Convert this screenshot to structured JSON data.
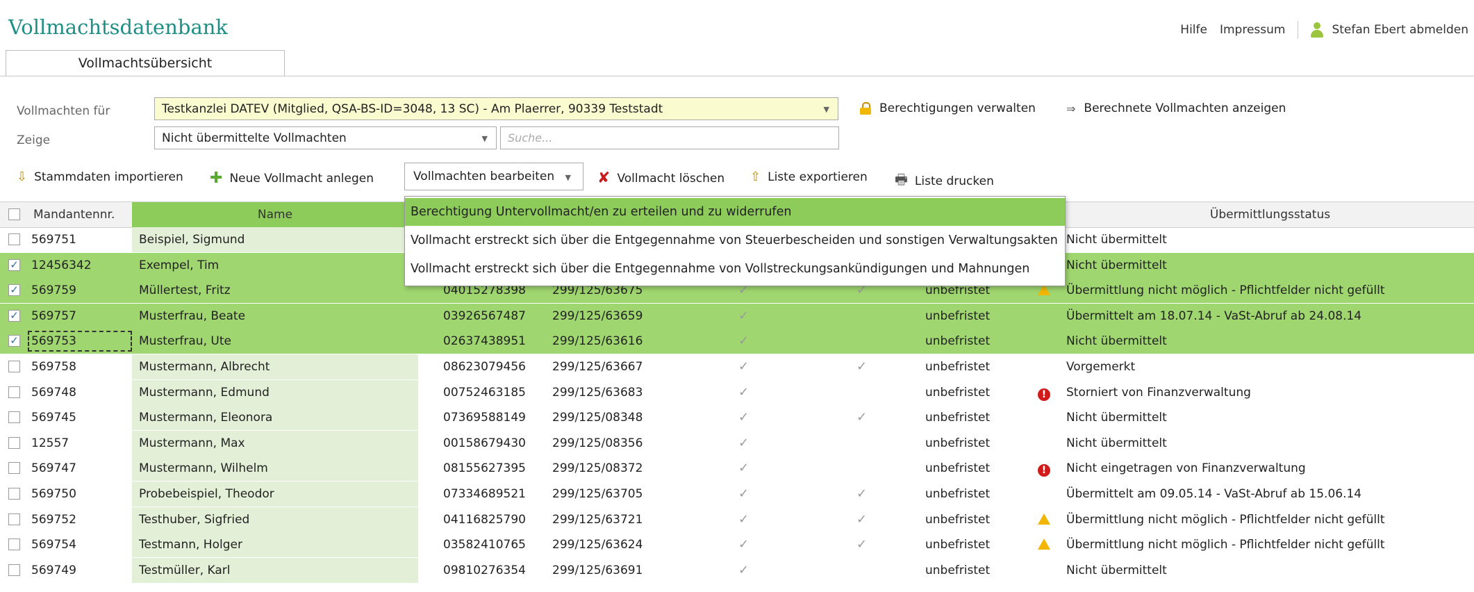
{
  "header": {
    "app_title": "Vollmachtsdatenbank",
    "help": "Hilfe",
    "imprint": "Impressum",
    "user_logout": "Stefan Ebert abmelden"
  },
  "tabs": [
    {
      "label": "Vollmachtsübersicht",
      "active": true
    }
  ],
  "filter": {
    "for_label": "Vollmachten für",
    "for_value": "Testkanzlei DATEV (Mitglied, QSA-BS-ID=3048, 13 SC) - Am Plaerrer, 90339 Teststadt",
    "show_label": "Zeige",
    "show_value": "Nicht übermittelte Vollmachten",
    "search_placeholder": "Suche...",
    "manage_permissions": "Berechtigungen verwalten",
    "show_calculated": "Berechnete Vollmachten anzeigen"
  },
  "toolbar": {
    "import": "Stammdaten importieren",
    "new": "Neue Vollmacht anlegen",
    "edit": "Vollmachten bearbeiten",
    "delete": "Vollmacht löschen",
    "export": "Liste exportieren",
    "print": "Liste drucken"
  },
  "menu": {
    "items": [
      "Berechtigung Untervollmacht/en zu erteilen und zu widerrufen",
      "Vollmacht erstreckt sich über die Entgegennahme von Steuerbescheiden und sonstigen Verwaltungsakten",
      "Vollmacht erstreckt sich über die Entgegennahme von Vollstreckungsankündigungen und Mahnungen"
    ]
  },
  "table": {
    "columns": {
      "id": "Mandantennr.",
      "name": "Name",
      "status": "Übermittlungsstatus"
    },
    "rows": [
      {
        "id": "569751",
        "name": "Beispiel, Sigmund",
        "num": "",
        "tax": "",
        "c1": false,
        "c2": false,
        "validity": "",
        "icon": "",
        "status": "Nicht übermittelt",
        "checked": false,
        "selected": false
      },
      {
        "id": "12456342",
        "name": "Exempel, Tim",
        "num": "",
        "tax": "",
        "c1": false,
        "c2": false,
        "validity": "",
        "icon": "",
        "status": "Nicht übermittelt",
        "checked": true,
        "selected": true
      },
      {
        "id": "569759",
        "name": "Müllertest, Fritz",
        "num": "04015278398",
        "tax": "299/125/63675",
        "c1": true,
        "c2": true,
        "validity": "unbefristet",
        "icon": "warning",
        "status": "Übermittlung nicht möglich - Pflichtfelder nicht gefüllt",
        "checked": true,
        "selected": true
      },
      {
        "id": "569757",
        "name": "Musterfrau, Beate",
        "num": "03926567487",
        "tax": "299/125/63659",
        "c1": true,
        "c2": false,
        "validity": "unbefristet",
        "icon": "",
        "status": "Übermittelt am 18.07.14 - VaSt-Abruf ab 24.08.14",
        "checked": true,
        "selected": true
      },
      {
        "id": "569753",
        "name": "Musterfrau, Ute",
        "num": "02637438951",
        "tax": "299/125/63616",
        "c1": true,
        "c2": false,
        "validity": "unbefristet",
        "icon": "",
        "status": "Nicht übermittelt",
        "checked": true,
        "selected": true
      },
      {
        "id": "569758",
        "name": "Mustermann, Albrecht",
        "num": "08623079456",
        "tax": "299/125/63667",
        "c1": true,
        "c2": true,
        "validity": "unbefristet",
        "icon": "",
        "status": "Vorgemerkt",
        "checked": false,
        "selected": false
      },
      {
        "id": "569748",
        "name": "Mustermann, Edmund",
        "num": "00752463185",
        "tax": "299/125/63683",
        "c1": true,
        "c2": false,
        "validity": "unbefristet",
        "icon": "error",
        "status": "Storniert von Finanzverwaltung",
        "checked": false,
        "selected": false
      },
      {
        "id": "569745",
        "name": "Mustermann, Eleonora",
        "num": "07369588149",
        "tax": "299/125/08348",
        "c1": true,
        "c2": true,
        "validity": "unbefristet",
        "icon": "",
        "status": "Nicht übermittelt",
        "checked": false,
        "selected": false
      },
      {
        "id": "12557",
        "name": "Mustermann, Max",
        "num": "00158679430",
        "tax": "299/125/08356",
        "c1": true,
        "c2": false,
        "validity": "unbefristet",
        "icon": "",
        "status": "Nicht übermittelt",
        "checked": false,
        "selected": false
      },
      {
        "id": "569747",
        "name": "Mustermann, Wilhelm",
        "num": "08155627395",
        "tax": "299/125/08372",
        "c1": true,
        "c2": false,
        "validity": "unbefristet",
        "icon": "error",
        "status": "Nicht eingetragen von Finanzverwaltung",
        "checked": false,
        "selected": false
      },
      {
        "id": "569750",
        "name": "Probebeispiel, Theodor",
        "num": "07334689521",
        "tax": "299/125/63705",
        "c1": true,
        "c2": true,
        "validity": "unbefristet",
        "icon": "",
        "status": "Übermittelt am 09.05.14 - VaSt-Abruf ab 15.06.14",
        "checked": false,
        "selected": false
      },
      {
        "id": "569752",
        "name": "Testhuber, Sigfried",
        "num": "04116825790",
        "tax": "299/125/63721",
        "c1": true,
        "c2": true,
        "validity": "unbefristet",
        "icon": "warning",
        "status": "Übermittlung nicht möglich - Pflichtfelder nicht gefüllt",
        "checked": false,
        "selected": false
      },
      {
        "id": "569754",
        "name": "Testmann, Holger",
        "num": "03582410765",
        "tax": "299/125/63624",
        "c1": true,
        "c2": true,
        "validity": "unbefristet",
        "icon": "warning",
        "status": "Übermittlung nicht möglich - Pflichtfelder nicht gefüllt",
        "checked": false,
        "selected": false
      },
      {
        "id": "569749",
        "name": "Testmüller, Karl",
        "num": "09810276354",
        "tax": "299/125/63691",
        "c1": true,
        "c2": false,
        "validity": "unbefristet",
        "icon": "",
        "status": "Nicht übermittelt",
        "checked": false,
        "selected": false
      }
    ]
  }
}
